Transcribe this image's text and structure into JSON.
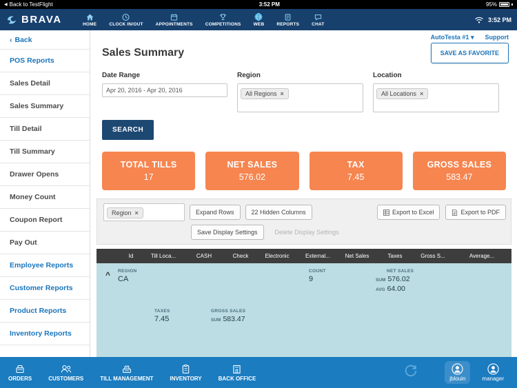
{
  "icons": {
    "close_glyph": "×",
    "caret_down": "▾",
    "chevron_left": "‹",
    "back_arrow": "◀",
    "collapse_caret": "^"
  },
  "status_bar": {
    "back": "Back to TestFlight",
    "battery": "95%",
    "time": "3:52 PM"
  },
  "header": {
    "brand": "BRAVA",
    "time": "3:52 PM",
    "nav": [
      {
        "label": "HOME"
      },
      {
        "label": "CLOCK IN/OUT"
      },
      {
        "label": "APPOINTMENTS"
      },
      {
        "label": "COMPETITIONS"
      },
      {
        "label": "WEB"
      },
      {
        "label": "REPORTS"
      },
      {
        "label": "CHAT"
      }
    ]
  },
  "sidebar": {
    "back": "Back",
    "items": [
      {
        "label": "POS Reports",
        "accent": true
      },
      {
        "label": "Sales Detail"
      },
      {
        "label": "Sales Summary"
      },
      {
        "label": "Till Detail"
      },
      {
        "label": "Till Summary"
      },
      {
        "label": "Drawer Opens"
      },
      {
        "label": "Money Count"
      },
      {
        "label": "Coupon Report"
      },
      {
        "label": "Pay Out"
      },
      {
        "label": "Employee Reports",
        "accent": true
      },
      {
        "label": "Customer Reports",
        "accent": true
      },
      {
        "label": "Product Reports",
        "accent": true
      },
      {
        "label": "Inventory Reports",
        "accent": true
      }
    ]
  },
  "main": {
    "account": "AutoTesta #1",
    "support": "Support",
    "title": "Sales Summary",
    "save_favorite": "SAVE AS FAVORITE",
    "filters": {
      "date_label": "Date Range",
      "date_value": "Apr 20, 2016 - Apr 20, 2016",
      "region_label": "Region",
      "region_tag": "All Regions",
      "location_label": "Location",
      "location_tag": "All Locations"
    },
    "search": "SEARCH",
    "kpis": [
      {
        "label": "TOTAL TILLS",
        "value": "17"
      },
      {
        "label": "NET SALES",
        "value": "576.02"
      },
      {
        "label": "TAX",
        "value": "7.45"
      },
      {
        "label": "GROSS SALES",
        "value": "583.47"
      }
    ],
    "toolbar": {
      "group_tag": "Region",
      "expand_rows": "Expand Rows",
      "hidden_columns": "22 Hidden Columns",
      "save_display": "Save Display Settings",
      "delete_display": "Delete Display Settings",
      "export_excel": "Export to Excel",
      "export_pdf": "Export to PDF"
    },
    "table": {
      "columns": [
        "Id",
        "Till Loca...",
        "CASH",
        "Check",
        "Electronic",
        "External...",
        "Net Sales",
        "Taxes",
        "Gross S...",
        "Average..."
      ],
      "group": {
        "region_label": "REGION",
        "region_value": "CA",
        "count_label": "COUNT",
        "count_value": "9",
        "net_sales_label": "NET SALES",
        "sum_label": "SUM",
        "net_sales_sum": "576.02",
        "avg_label": "AVG",
        "net_sales_avg": "64.00",
        "taxes_label": "TAXES",
        "taxes_value": "7.45",
        "gross_label": "GROSS SALES",
        "gross_sum": "583.47"
      }
    }
  },
  "footer": {
    "items": [
      {
        "label": "ORDERS"
      },
      {
        "label": "CUSTOMERS"
      },
      {
        "label": "TILL MANAGEMENT"
      },
      {
        "label": "INVENTORY"
      },
      {
        "label": "BACK OFFICE"
      }
    ],
    "users": [
      {
        "name": "jblouin"
      },
      {
        "name": "manager"
      }
    ]
  }
}
